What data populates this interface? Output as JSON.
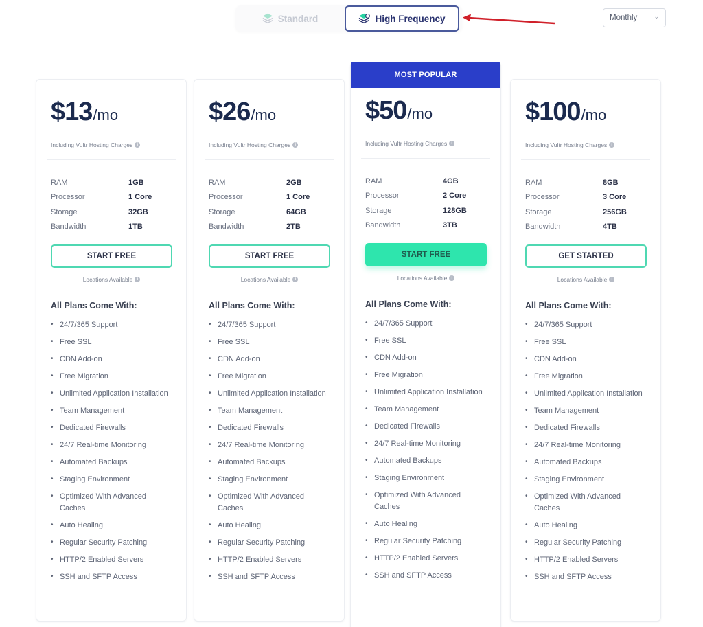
{
  "toggle": {
    "options": [
      {
        "label": "Standard",
        "icon": "layers-icon",
        "selected": false
      },
      {
        "label": "High Frequency",
        "icon": "layers-bolt-icon",
        "selected": true
      }
    ]
  },
  "annotation": {
    "icon": "red-arrow-icon",
    "color": "#d0202a"
  },
  "billing": {
    "selected": "Monthly"
  },
  "colors": {
    "accent": "#2ee5ad",
    "popular_banner": "#2a3ec9",
    "text_dark": "#1b2a4e"
  },
  "plans": [
    {
      "price": "$13",
      "per": "/mo",
      "including": "Including Vultr Hosting Charges",
      "specs": [
        {
          "label": "RAM",
          "value": "1GB"
        },
        {
          "label": "Processor",
          "value": "1 Core"
        },
        {
          "label": "Storage",
          "value": "32GB"
        },
        {
          "label": "Bandwidth",
          "value": "1TB"
        }
      ],
      "cta": "START FREE",
      "locations": "Locations Available"
    },
    {
      "price": "$26",
      "per": "/mo",
      "including": "Including Vultr Hosting Charges",
      "specs": [
        {
          "label": "RAM",
          "value": "2GB"
        },
        {
          "label": "Processor",
          "value": "1 Core"
        },
        {
          "label": "Storage",
          "value": "64GB"
        },
        {
          "label": "Bandwidth",
          "value": "2TB"
        }
      ],
      "cta": "START FREE",
      "locations": "Locations Available"
    },
    {
      "badge": "MOST POPULAR",
      "price": "$50",
      "per": "/mo",
      "including": "Including Vultr Hosting Charges",
      "specs": [
        {
          "label": "RAM",
          "value": "4GB"
        },
        {
          "label": "Processor",
          "value": "2 Core"
        },
        {
          "label": "Storage",
          "value": "128GB"
        },
        {
          "label": "Bandwidth",
          "value": "3TB"
        }
      ],
      "cta": "START FREE",
      "locations": "Locations Available"
    },
    {
      "price": "$100",
      "per": "/mo",
      "including": "Including Vultr Hosting Charges",
      "specs": [
        {
          "label": "RAM",
          "value": "8GB"
        },
        {
          "label": "Processor",
          "value": "3 Core"
        },
        {
          "label": "Storage",
          "value": "256GB"
        },
        {
          "label": "Bandwidth",
          "value": "4TB"
        }
      ],
      "cta": "GET STARTED",
      "locations": "Locations Available"
    }
  ],
  "all_plans_heading": "All Plans Come With:",
  "features": [
    "24/7/365 Support",
    "Free SSL",
    "CDN Add-on",
    "Free Migration",
    "Unlimited Application Installation",
    "Team Management",
    "Dedicated Firewalls",
    "24/7 Real-time Monitoring",
    "Automated Backups",
    "Staging Environment",
    "Optimized With Advanced Caches",
    "Auto Healing",
    "Regular Security Patching",
    "HTTP/2 Enabled Servers",
    "SSH and SFTP Access"
  ]
}
